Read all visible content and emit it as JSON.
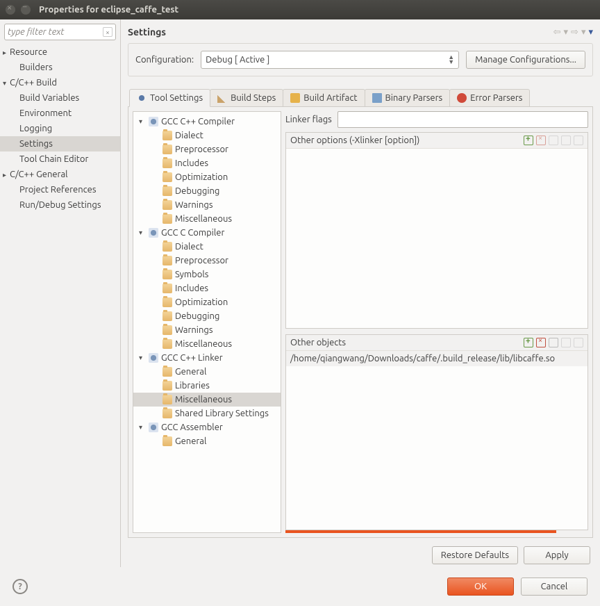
{
  "window": {
    "title": "Properties for eclipse_caffe_test"
  },
  "nav": {
    "filter_placeholder": "type filter text",
    "items": [
      {
        "label": "Resource",
        "level": 0,
        "expandable": true,
        "open": false
      },
      {
        "label": "Builders",
        "level": 1,
        "expandable": false
      },
      {
        "label": "C/C++ Build",
        "level": 0,
        "expandable": true,
        "open": true
      },
      {
        "label": "Build Variables",
        "level": 1,
        "expandable": false
      },
      {
        "label": "Environment",
        "level": 1,
        "expandable": false
      },
      {
        "label": "Logging",
        "level": 1,
        "expandable": false
      },
      {
        "label": "Settings",
        "level": 1,
        "expandable": false,
        "selected": true
      },
      {
        "label": "Tool Chain Editor",
        "level": 1,
        "expandable": false
      },
      {
        "label": "C/C++ General",
        "level": 0,
        "expandable": true,
        "open": false
      },
      {
        "label": "Project References",
        "level": 1,
        "expandable": false
      },
      {
        "label": "Run/Debug Settings",
        "level": 1,
        "expandable": false
      }
    ]
  },
  "main": {
    "title": "Settings",
    "config_label": "Configuration:",
    "config_value": "Debug  [ Active ]",
    "manage_button": "Manage Configurations...",
    "tabs": [
      "Tool Settings",
      "Build Steps",
      "Build Artifact",
      "Binary Parsers",
      "Error Parsers"
    ],
    "tool_tree": [
      {
        "label": "GCC C++ Compiler",
        "type": "tool",
        "parent": true
      },
      {
        "label": "Dialect",
        "type": "folder"
      },
      {
        "label": "Preprocessor",
        "type": "folder"
      },
      {
        "label": "Includes",
        "type": "folder"
      },
      {
        "label": "Optimization",
        "type": "folder"
      },
      {
        "label": "Debugging",
        "type": "folder"
      },
      {
        "label": "Warnings",
        "type": "folder"
      },
      {
        "label": "Miscellaneous",
        "type": "folder"
      },
      {
        "label": "GCC C Compiler",
        "type": "tool",
        "parent": true
      },
      {
        "label": "Dialect",
        "type": "folder"
      },
      {
        "label": "Preprocessor",
        "type": "folder"
      },
      {
        "label": "Symbols",
        "type": "folder"
      },
      {
        "label": "Includes",
        "type": "folder"
      },
      {
        "label": "Optimization",
        "type": "folder"
      },
      {
        "label": "Debugging",
        "type": "folder"
      },
      {
        "label": "Warnings",
        "type": "folder"
      },
      {
        "label": "Miscellaneous",
        "type": "folder"
      },
      {
        "label": "GCC C++ Linker",
        "type": "tool",
        "parent": true
      },
      {
        "label": "General",
        "type": "folder"
      },
      {
        "label": "Libraries",
        "type": "folder"
      },
      {
        "label": "Miscellaneous",
        "type": "folder",
        "selected": true
      },
      {
        "label": "Shared Library Settings",
        "type": "folder"
      },
      {
        "label": "GCC Assembler",
        "type": "tool",
        "parent": true
      },
      {
        "label": "General",
        "type": "folder"
      }
    ],
    "form": {
      "linker_flags_label": "Linker flags",
      "linker_flags_value": "",
      "other_options_label": "Other options (-Xlinker [option])",
      "other_objects_label": "Other objects",
      "other_objects_items": [
        "/home/qiangwang/Downloads/caffe/.build_release/lib/libcaffe.so"
      ]
    },
    "restore_button": "Restore Defaults",
    "apply_button": "Apply"
  },
  "footer": {
    "ok": "OK",
    "cancel": "Cancel"
  }
}
